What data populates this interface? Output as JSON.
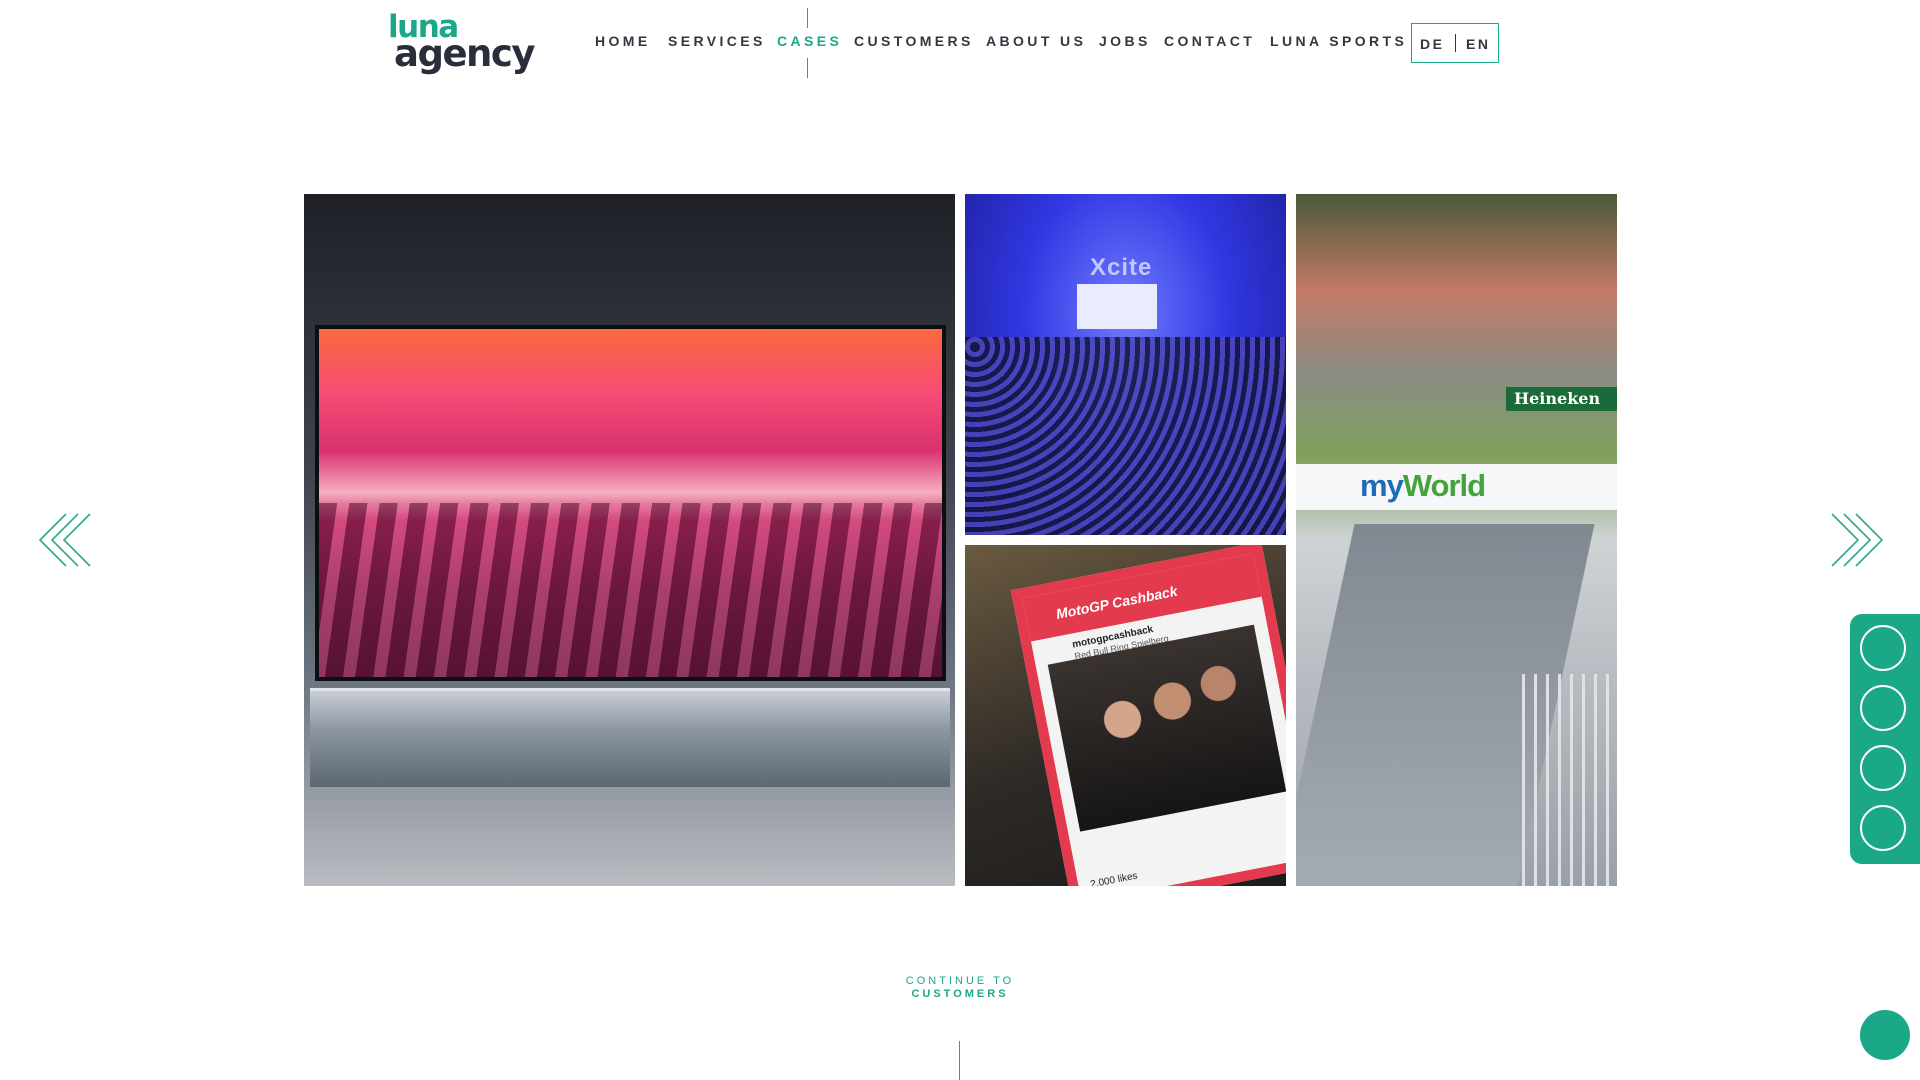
{
  "brand": {
    "logo_line1": "luna",
    "logo_line2": "agency"
  },
  "nav": {
    "items": [
      {
        "label": "HOME"
      },
      {
        "label": "SERVICES"
      },
      {
        "label": "CASES"
      },
      {
        "label": "CUSTOMERS"
      },
      {
        "label": "ABOUT US"
      },
      {
        "label": "JOBS"
      },
      {
        "label": "CONTACT"
      },
      {
        "label": "LUNA SPORTS"
      }
    ],
    "active": "CASES",
    "languages": [
      "DE",
      "EN"
    ]
  },
  "gallery": {
    "tiles": [
      {
        "subject": "lg-oled-tv"
      },
      {
        "subject": "xcite-conference",
        "logo_text": "Xcite"
      },
      {
        "subject": "motogp-cashback",
        "card_title": "MotoGP Cashback",
        "account": "motogpcashback",
        "location": "Red Bull Ring Spielberg",
        "likes": "2.000 likes"
      },
      {
        "subject": "formula-1-race",
        "banner": [
          "my",
          "World"
        ],
        "sponsor": "Heineken"
      }
    ]
  },
  "continue": {
    "label": "CONTINUE TO",
    "link": "CUSTOMERS"
  },
  "colors": {
    "accent": "#1aa889",
    "text": "#333740",
    "background": "#ffffff"
  },
  "icons": {
    "prev": "double-chevron-left-icon",
    "next": "double-chevron-right-icon",
    "social": [
      "social-circle-icon",
      "social-circle-icon",
      "social-circle-icon",
      "social-circle-icon"
    ],
    "fab": "chat-bubble-icon"
  }
}
